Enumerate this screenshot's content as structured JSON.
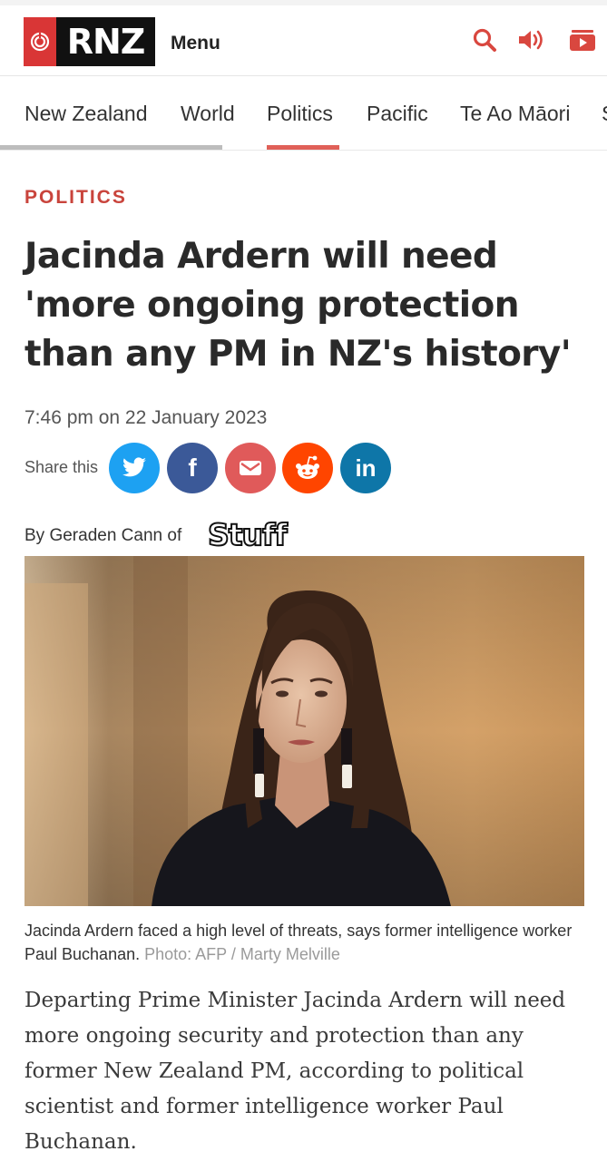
{
  "header": {
    "logo_text": "RNZ",
    "menu_label": "Menu",
    "icons": [
      "search-icon",
      "audio-icon",
      "video-icon"
    ]
  },
  "nav": {
    "items": [
      "New Zealand",
      "World",
      "Politics",
      "Pacific",
      "Te Ao Māori",
      "S"
    ],
    "active": "Politics"
  },
  "article": {
    "section": "POLITICS",
    "headline": "Jacinda Ardern will need 'more ongoing protection than any PM in NZ's history'",
    "date": "7:46 pm on 22 January 2023",
    "share_label": "Share this",
    "share_buttons": [
      {
        "name": "twitter",
        "glyph": "",
        "color": "#1da1f2"
      },
      {
        "name": "facebook",
        "glyph": "f",
        "color": "#3b5998"
      },
      {
        "name": "email",
        "glyph": "",
        "color": "#e05a5a"
      },
      {
        "name": "reddit",
        "glyph": "",
        "color": "#ff4500"
      },
      {
        "name": "linkedin",
        "glyph": "in",
        "color": "#0e76a8"
      }
    ],
    "byline": "By Geraden Cann of",
    "partner_logo": "Stuff",
    "caption": "Jacinda Ardern faced a high level of threats, says former intelligence worker Paul Buchanan.",
    "photo_credit": "Photo: AFP / Marty Melville",
    "body": "Departing Prime Minister Jacinda Ardern will need more ongoing security and protection than any former New Zealand PM, according to political scientist and former intelligence worker Paul Buchanan."
  },
  "colors": {
    "brand_red": "#d93636",
    "section_red": "#c9443c",
    "nav_active": "#e06058"
  }
}
